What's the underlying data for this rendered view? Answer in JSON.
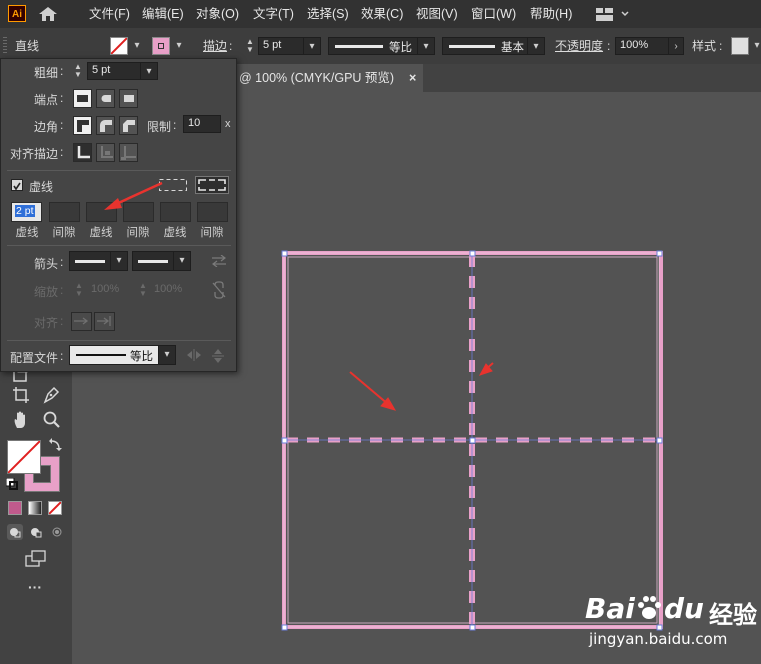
{
  "app": {
    "logo": "Ai"
  },
  "menu": [
    "文件(F)",
    "编辑(E)",
    "对象(O)",
    "文字(T)",
    "选择(S)",
    "效果(C)",
    "视图(V)",
    "窗口(W)",
    "帮助(H)"
  ],
  "control_bar": {
    "tool_name": "直线",
    "stroke_label": "描边",
    "stroke_value": "5 pt",
    "profile1_label": "等比",
    "profile2_label": "基本",
    "opacity_label": "不透明度",
    "opacity_value": "100%",
    "style_label": "样式"
  },
  "document_tab": {
    "title": "@ 100% (CMYK/GPU 预览)",
    "close": "×"
  },
  "stroke_panel": {
    "weight_label": "粗细",
    "weight_value": "5 pt",
    "cap_label": "端点",
    "corner_label": "边角",
    "limit_label": "限制",
    "limit_value": "10",
    "limit_unit": "x",
    "align_label": "对齐描边",
    "dashed_label": "虚线",
    "dashed_checked": true,
    "dash_values": [
      "2 pt",
      "",
      "",
      "",
      "",
      ""
    ],
    "dash_labels": [
      "虚线",
      "间隙",
      "虚线",
      "间隙",
      "虚线",
      "间隙"
    ],
    "arrow_label": "箭头",
    "scale_label": "缩放",
    "scale_values": [
      "100%",
      "100%"
    ],
    "align_arrow_label": "对齐",
    "profile_label": "配置文件",
    "profile_value": "等比"
  },
  "watermark": {
    "brand_text": "Bai",
    "brand_text2": "du",
    "brand_cn": "经验",
    "url": "jingyan.baidu.com"
  },
  "colors": {
    "accent_pink": "#e8a0c8",
    "annotation_red": "#e8332e",
    "canvas": "#535353",
    "panel": "#454545"
  }
}
